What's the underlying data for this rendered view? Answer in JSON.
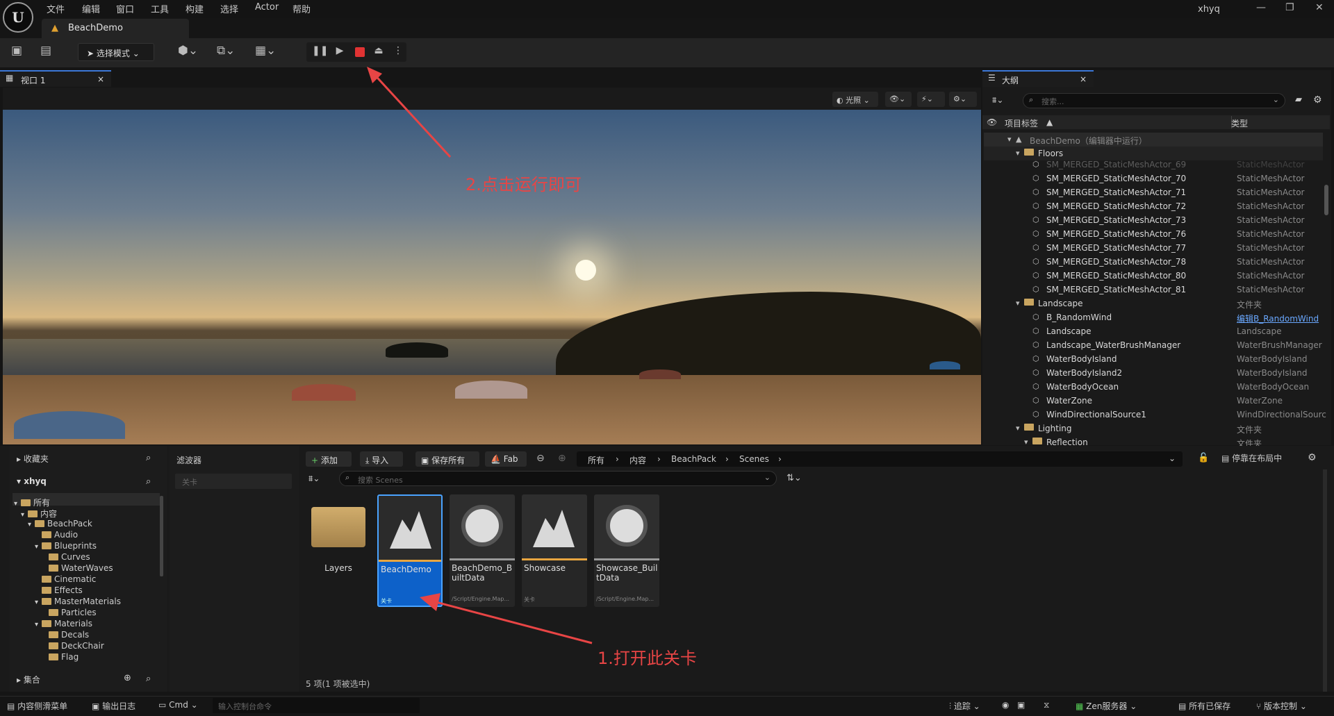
{
  "menubar": {
    "items": [
      "文件",
      "编辑",
      "窗口",
      "工具",
      "构建",
      "选择",
      "Actor",
      "帮助"
    ],
    "user": "xhyq"
  },
  "document_tab": {
    "label": "BeachDemo"
  },
  "toolbar": {
    "mode_label": "选择模式"
  },
  "viewport": {
    "tab_label": "视口 1",
    "lighting_button": "光照"
  },
  "annotations": {
    "step1": "1.打开此关卡",
    "step2": "2.点击运行即可"
  },
  "outliner": {
    "tab_label": "大纲",
    "search_placeholder": "搜索...",
    "col_label": "项目标签",
    "col_type": "类型",
    "rows": [
      {
        "name": "BeachDemo（编辑器中运行）",
        "type": ""
      },
      {
        "name": "Floors",
        "type": ""
      },
      {
        "name": "SM_MERGED_StaticMeshActor_69",
        "type": "StaticMeshActor"
      },
      {
        "name": "SM_MERGED_StaticMeshActor_70",
        "type": "StaticMeshActor"
      },
      {
        "name": "SM_MERGED_StaticMeshActor_71",
        "type": "StaticMeshActor"
      },
      {
        "name": "SM_MERGED_StaticMeshActor_72",
        "type": "StaticMeshActor"
      },
      {
        "name": "SM_MERGED_StaticMeshActor_73",
        "type": "StaticMeshActor"
      },
      {
        "name": "SM_MERGED_StaticMeshActor_76",
        "type": "StaticMeshActor"
      },
      {
        "name": "SM_MERGED_StaticMeshActor_77",
        "type": "StaticMeshActor"
      },
      {
        "name": "SM_MERGED_StaticMeshActor_78",
        "type": "StaticMeshActor"
      },
      {
        "name": "SM_MERGED_StaticMeshActor_80",
        "type": "StaticMeshActor"
      },
      {
        "name": "SM_MERGED_StaticMeshActor_81",
        "type": "StaticMeshActor"
      },
      {
        "name": "Landscape",
        "type": "文件夹"
      },
      {
        "name": "B_RandomWind",
        "type": "编辑B_RandomWind"
      },
      {
        "name": "Landscape",
        "type": "Landscape"
      },
      {
        "name": "Landscape_WaterBrushManager",
        "type": "WaterBrushManager"
      },
      {
        "name": "WaterBodyIsland",
        "type": "WaterBodyIsland"
      },
      {
        "name": "WaterBodyIsland2",
        "type": "WaterBodyIsland"
      },
      {
        "name": "WaterBodyOcean",
        "type": "WaterBodyOcean"
      },
      {
        "name": "WaterZone",
        "type": "WaterZone"
      },
      {
        "name": "WindDirectionalSource1",
        "type": "WindDirectionalSourc"
      },
      {
        "name": "Lighting",
        "type": "文件夹"
      },
      {
        "name": "Reflection",
        "type": "文件夹"
      }
    ]
  },
  "content_browser": {
    "favorites": "收藏夹",
    "root": "xhyq",
    "tree": [
      {
        "label": "所有",
        "depth": 0
      },
      {
        "label": "内容",
        "depth": 1
      },
      {
        "label": "BeachPack",
        "depth": 2
      },
      {
        "label": "Audio",
        "depth": 3
      },
      {
        "label": "Blueprints",
        "depth": 3
      },
      {
        "label": "Curves",
        "depth": 4
      },
      {
        "label": "WaterWaves",
        "depth": 4
      },
      {
        "label": "Cinematic",
        "depth": 3
      },
      {
        "label": "Effects",
        "depth": 3
      },
      {
        "label": "MasterMaterials",
        "depth": 3
      },
      {
        "label": "Particles",
        "depth": 4
      },
      {
        "label": "Materials",
        "depth": 3
      },
      {
        "label": "Decals",
        "depth": 4
      },
      {
        "label": "DeckChair",
        "depth": 4
      },
      {
        "label": "Flag",
        "depth": 4
      }
    ],
    "collections": "集合",
    "filters_title": "滤波器",
    "filter_value": "关卡",
    "add_button": "添加",
    "import_button": "导入",
    "save_all_button": "保存所有",
    "fab_button": "Fab",
    "breadcrumb": [
      "所有",
      "内容",
      "BeachPack",
      "Scenes"
    ],
    "dock_label": "停靠在布局中",
    "search_placeholder": "搜索 Scenes",
    "assets": [
      {
        "name": "Layers",
        "sub": ""
      },
      {
        "name": "BeachDemo",
        "sub": "关卡"
      },
      {
        "name": "BeachDemo_BuiltData",
        "sub": "/Script/Engine.Map..."
      },
      {
        "name": "Showcase",
        "sub": "关卡"
      },
      {
        "name": "Showcase_BuiltData",
        "sub": "/Script/Engine.Map..."
      }
    ],
    "status": "5 项(1 项被选中)"
  },
  "statusbar": {
    "content_drawer": "内容侧滑菜单",
    "output_log": "输出日志",
    "cmd": "Cmd",
    "cmd_placeholder": "输入控制台命令",
    "trace": "追踪",
    "zen": "Zen服务器",
    "saved": "所有已保存",
    "source_control": "版本控制"
  }
}
